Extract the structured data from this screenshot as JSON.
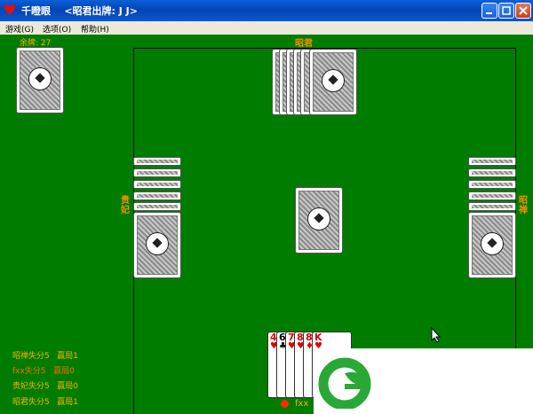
{
  "window": {
    "title": "千瞪眼    <昭君出牌: J J>"
  },
  "menu": [
    "游戏(G)",
    "选项(O)",
    "帮助(H)"
  ],
  "table": {
    "remaining": "余牌: 27",
    "players": {
      "top": "昭君",
      "left": "贵妃",
      "right": "昭禅",
      "bottom": "fxx"
    },
    "scores": [
      {
        "text": "昭禅失分5   赢局1",
        "highlight": false
      },
      {
        "text": "fxx失分5   赢局0",
        "highlight": true
      },
      {
        "text": "贵妃失分5   赢局0",
        "highlight": false
      },
      {
        "text": "昭君失分5   赢局1",
        "highlight": false
      }
    ],
    "hand": [
      {
        "rank": "4",
        "suit": "♥",
        "color": "red"
      },
      {
        "rank": "6",
        "suit": "♣",
        "color": "black"
      },
      {
        "rank": "7",
        "suit": "♥",
        "color": "red"
      },
      {
        "rank": "8",
        "suit": "♥",
        "color": "red"
      },
      {
        "rank": "8",
        "suit": "♦",
        "color": "red"
      },
      {
        "rank": "K",
        "suit": "♥",
        "color": "red"
      }
    ]
  },
  "colors": {
    "felt": "#007d00",
    "label": "#ff8c00"
  }
}
